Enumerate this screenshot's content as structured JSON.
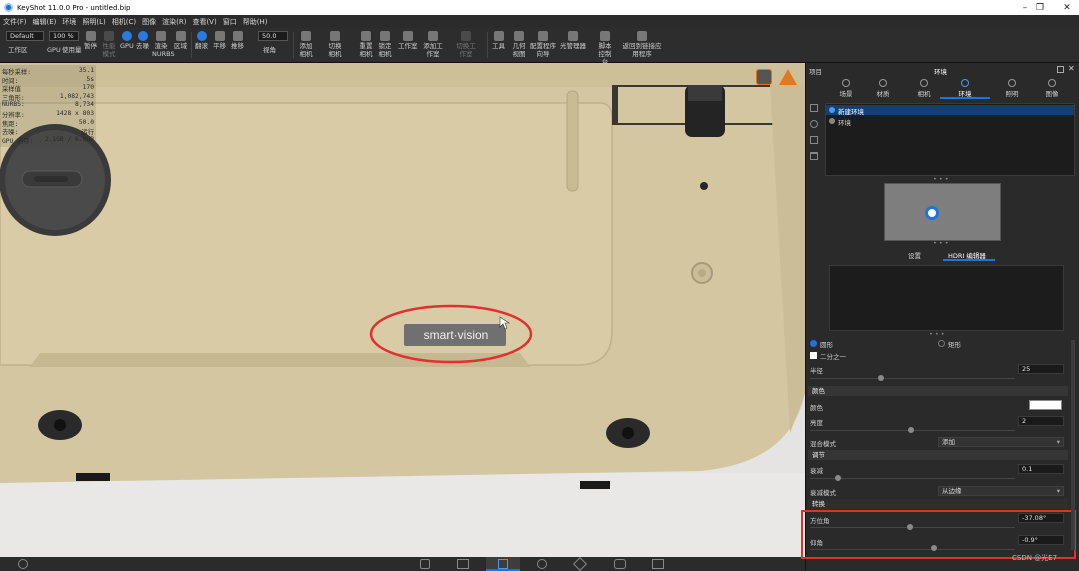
{
  "window": {
    "title": "KeyShot 11.0.0 Pro  - untitled.bip"
  },
  "menu": [
    "文件(F)",
    "编辑(E)",
    "环境",
    "照明(L)",
    "相机(C)",
    "图像",
    "渲染(R)",
    "查看(V)",
    "窗口",
    "帮助(H)"
  ],
  "toolbar": {
    "env_select": "Default",
    "zoom_value": "100 %",
    "fov_value": "50.0",
    "items": [
      "工作区",
      "GPU",
      "使用量",
      "暂停",
      "性能模式",
      "GPU",
      "去噪",
      "渲染NURBS",
      "区域",
      "翻滚",
      "平移",
      "推移",
      "视角",
      "添加相机",
      "切换相机",
      "重置相机",
      "锁定相机",
      "工作室",
      "添加工作室",
      "切换工作室",
      "工具",
      "几何视图",
      "配置程序向导",
      "光管理器",
      "脚本控制台",
      "返回到链接应用程序"
    ]
  },
  "hud": {
    "rows": [
      {
        "k": "每秒采样:",
        "v": "35.1"
      },
      {
        "k": "时间:",
        "v": "5s"
      },
      {
        "k": "采样值",
        "v": "170"
      },
      {
        "k": "三角形:",
        "v": "1,082,743"
      },
      {
        "k": "NURBS:",
        "v": "8,734"
      },
      {
        "k": "分辨率:",
        "v": "1428 x 803"
      },
      {
        "k": "焦距:",
        "v": "50.0"
      },
      {
        "k": "去噪:",
        "v": "运行"
      },
      {
        "k": "GPU 内存:",
        "v": "2.1GB / 6.0GB"
      }
    ]
  },
  "scene": {
    "badge_text": "smart·vision"
  },
  "panel": {
    "header_left": "项目",
    "header_title": "环境",
    "tabs": [
      "场景",
      "材质",
      "相机",
      "环境",
      "照明",
      "图像"
    ],
    "active_tab": 3,
    "env_list": [
      "新建环境",
      "环境"
    ],
    "subtabs": [
      "设置",
      "HDRI 编辑器"
    ],
    "active_subtab": 1,
    "shape_round": "圆形",
    "shape_rect": "矩形",
    "half_label": "二分之一",
    "radius_label": "半径",
    "radius_value": "25",
    "color_section": "颜色",
    "color_label": "颜色",
    "brightness_label": "亮度",
    "brightness_value": "2",
    "blend_label": "混合模式",
    "blend_value": "添加",
    "adjust_section": "调节",
    "falloff_label": "衰减",
    "falloff_value": "0.1",
    "falloff_mode_label": "衰减模式",
    "falloff_mode_value": "从边缘",
    "transform_section": "转换",
    "azimuth_label": "方位角",
    "azimuth_value": "-37.08°",
    "elevation_label": "仰角",
    "elevation_value": "-0.9°"
  },
  "watermark": "CSDN @光E7",
  "colors": {
    "accent": "#1f73e0",
    "highlight": "#e03030",
    "body": "#d4c6a0"
  }
}
